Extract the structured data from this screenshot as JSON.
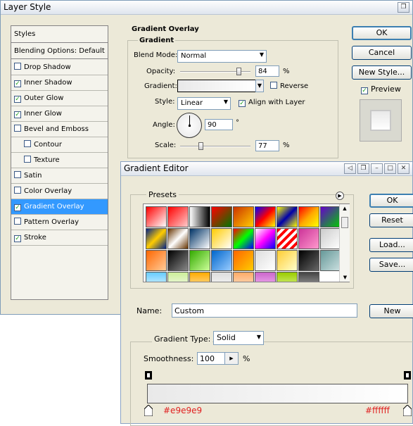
{
  "layer_style": {
    "title": "Layer Style",
    "styles_header": "Styles",
    "blending_options": "Blending Options: Default",
    "items": [
      {
        "label": "Drop Shadow",
        "checked": false,
        "indent": false
      },
      {
        "label": "Inner Shadow",
        "checked": true,
        "indent": false
      },
      {
        "label": "Outer Glow",
        "checked": true,
        "indent": false
      },
      {
        "label": "Inner Glow",
        "checked": true,
        "indent": false
      },
      {
        "label": "Bevel and Emboss",
        "checked": false,
        "indent": false
      },
      {
        "label": "Contour",
        "checked": false,
        "indent": true
      },
      {
        "label": "Texture",
        "checked": false,
        "indent": true
      },
      {
        "label": "Satin",
        "checked": false,
        "indent": false
      },
      {
        "label": "Color Overlay",
        "checked": false,
        "indent": false
      },
      {
        "label": "Gradient Overlay",
        "checked": true,
        "indent": false,
        "selected": true
      },
      {
        "label": "Pattern Overlay",
        "checked": false,
        "indent": false
      },
      {
        "label": "Stroke",
        "checked": true,
        "indent": false
      }
    ],
    "section_title": "Gradient Overlay",
    "subsection_title": "Gradient",
    "blend_mode_label": "Blend Mode:",
    "blend_mode_value": "Normal",
    "opacity_label": "Opacity:",
    "opacity_value": "84",
    "opacity_unit": "%",
    "opacity_fraction": 0.84,
    "gradient_label": "Gradient:",
    "reverse_label": "Reverse",
    "style_label": "Style:",
    "style_value": "Linear",
    "align_label": "Align with Layer",
    "angle_label": "Angle:",
    "angle_value": "90",
    "angle_unit": "°",
    "scale_label": "Scale:",
    "scale_value": "77",
    "scale_unit": "%",
    "scale_fraction": 0.3,
    "ok_label": "OK",
    "cancel_label": "Cancel",
    "new_style_label": "New Style...",
    "preview_label": "Preview"
  },
  "gradient_editor": {
    "title": "Gradient Editor",
    "presets_label": "Presets",
    "ok_label": "OK",
    "reset_label": "Reset",
    "load_label": "Load...",
    "save_label": "Save...",
    "name_label": "Name:",
    "name_value": "Custom",
    "new_label": "New",
    "gradient_type_label": "Gradient Type:",
    "gradient_type_value": "Solid",
    "smoothness_label": "Smoothness:",
    "smoothness_value": "100",
    "smoothness_unit": "%",
    "stop_left_color": "#e9e9e9",
    "stop_right_color": "#ffffff",
    "stop_left_label": "#e9e9e9",
    "stop_right_label": "#ffffff",
    "preset_gradients": [
      "linear-gradient(135deg,#ff0000,#ffffff)",
      "linear-gradient(135deg,#ff0000,#ffcccc)",
      "linear-gradient(90deg,#ffffff,#000000)",
      "linear-gradient(135deg,#ff0000,#007700)",
      "linear-gradient(135deg,#cc3300,#ffcc00)",
      "linear-gradient(135deg,#0000ff,#ff0000,#ffff00)",
      "linear-gradient(135deg,#ffff00,#0000aa,#ffff00)",
      "linear-gradient(135deg,#ff0000,#ffaa00,#ffff00)",
      "linear-gradient(135deg,#6600cc,#00cc00)",
      "linear-gradient(135deg,#002288,#ffcc00,#002288)",
      "linear-gradient(135deg,#663300,#ffffff,#663300)",
      "linear-gradient(135deg,#003366,#ffffff)",
      "linear-gradient(135deg,#ffcc00,#ffffff)",
      "linear-gradient(135deg,#ff0000,#00ff00,#0000ff)",
      "linear-gradient(135deg,#ffffff,#ff00ff,#0000ff)",
      "repeating-linear-gradient(135deg,#ff0000 0 4px,#ffffff 4px 8px)",
      "linear-gradient(135deg,#cc3399,#ff99cc)",
      "linear-gradient(135deg,#cccccc,#ffffff)",
      "linear-gradient(135deg,#ff6600,#ffcc99)",
      "linear-gradient(135deg,#000000,#888888)",
      "linear-gradient(135deg,#33aa00,#ccff99)",
      "linear-gradient(135deg,#0066cc,#99ccff)",
      "linear-gradient(135deg,#ff6600,#ffcc00)",
      "linear-gradient(135deg,#dddddd,#ffffff)",
      "linear-gradient(135deg,#ffcc33,#ffffcc)",
      "linear-gradient(135deg,#000000,#666666)",
      "linear-gradient(135deg,#669999,#cce0e0)",
      "linear-gradient(180deg,#66ccff,#ffffff)",
      "linear-gradient(180deg,#ccee99,#ffffff)",
      "linear-gradient(180deg,#ffaa00,#ffeecc)",
      "linear-gradient(180deg,#dddddd,#ffffff)",
      "linear-gradient(180deg,#ffaa66,#ffeedd)",
      "linear-gradient(180deg,#cc66cc,#ffccff)",
      "linear-gradient(180deg,#99cc00,#eeffaa)",
      "linear-gradient(180deg,#444444,#bbbbbb)"
    ]
  }
}
